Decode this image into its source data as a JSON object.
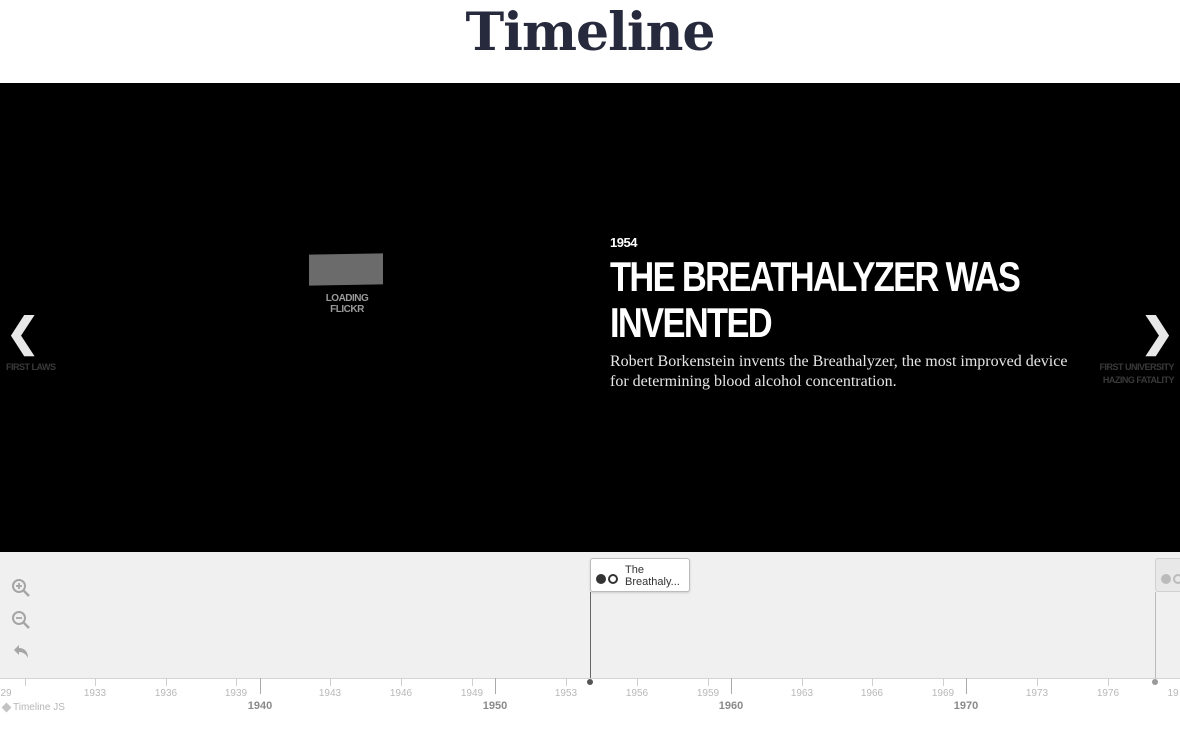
{
  "page": {
    "title": "Timeline"
  },
  "slide": {
    "date": "1954",
    "headline": "THE BREATHALYZER WAS INVENTED",
    "body": "Robert Borkenstein invents the Breathalyzer, the most improved device for determining blood alcohol concentration.",
    "media_label": "LOADING FLICKR"
  },
  "nav": {
    "prev_label": "FIRST LAWS",
    "next_label_1": "FIRST UNIVERSITY",
    "next_label_2": "HAZING FATALITY"
  },
  "navbar": {
    "marker_label_1": "The",
    "marker_label_2": "Breathaly...",
    "brand": "Timeline JS"
  },
  "axis": {
    "minor_ticks": [
      "29",
      "1933",
      "1936",
      "1939",
      "1943",
      "1946",
      "1949",
      "1953",
      "1956",
      "1959",
      "1963",
      "1966",
      "1969",
      "1973",
      "1976",
      "19"
    ],
    "major_ticks": [
      "1940",
      "1950",
      "1960",
      "1970"
    ]
  }
}
